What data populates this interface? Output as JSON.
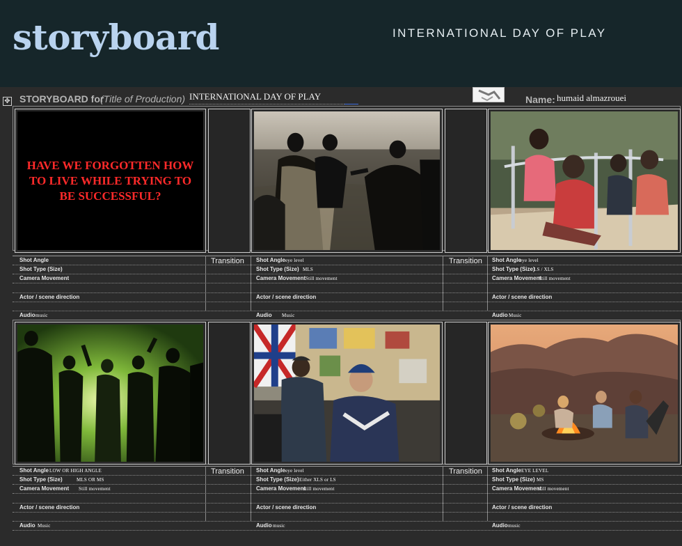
{
  "header": {
    "brand": "storyboard",
    "event": "INTERNATIONAL DAY OF PLAY"
  },
  "sheet": {
    "storyboard_label": "STORYBOARD for",
    "title_placeholder": "(Title of Production)",
    "title_value": "INTERNATIONAL DAY OF PLAY",
    "name_label": "Name:",
    "name_value": "humaid almazrouei"
  },
  "labels": {
    "shot_angle": "Shot Angle",
    "shot_type": "Shot Type (Size)",
    "camera_movement": "Camera Movement",
    "actor_direction": "Actor / scene direction",
    "audio": "Audio",
    "transition": "Transition"
  },
  "frames": [
    {
      "slide_text": "HAVE WE FORGOTTEN HOW TO LIVE WHILE TRYING TO BE SUCCESSFUL?",
      "shot_angle": "",
      "shot_type": "",
      "camera_movement": "",
      "audio": "music"
    },
    {
      "shot_angle": "eye level",
      "shot_type": "MLS",
      "camera_movement": "Still movement",
      "audio": "Music"
    },
    {
      "shot_angle": "eye level",
      "shot_type": "LS / XLS",
      "camera_movement": "Still movement",
      "audio": "Music"
    },
    {
      "shot_angle": "LOW OR HIGH ANGLE",
      "shot_type": "MLS OR MS",
      "camera_movement": "Still movement",
      "audio": "Music"
    },
    {
      "shot_angle": "eye level",
      "shot_type": "Either XLS or LS",
      "camera_movement": "still movement",
      "audio": "music"
    },
    {
      "shot_angle": "EYE LEVEL",
      "shot_type": "MS",
      "camera_movement": "still movement",
      "audio": "music"
    }
  ],
  "colors": {
    "header_bg": "#16262a",
    "brand": "#b9d3ef",
    "sheet_bg": "#2b2b2b",
    "slide_text": "#ff2a2a"
  }
}
